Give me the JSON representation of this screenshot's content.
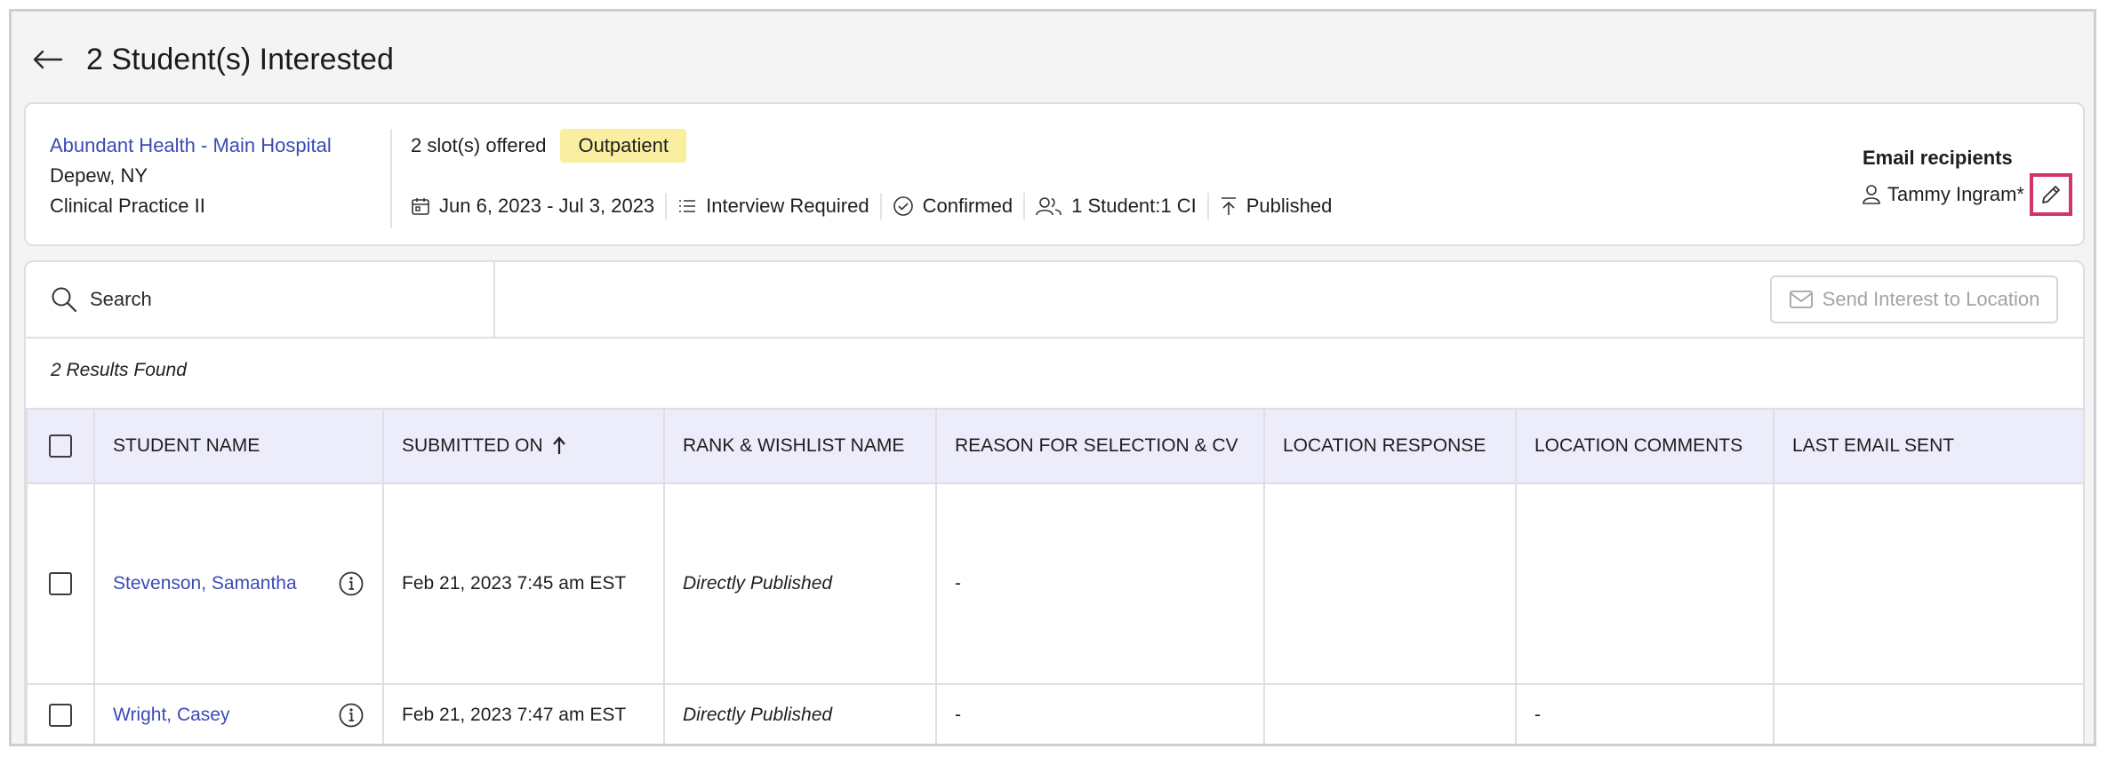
{
  "header": {
    "title": "2 Student(s) Interested"
  },
  "location": {
    "name": "Abundant Health - Main Hospital",
    "city": "Depew, NY",
    "program": "Clinical Practice II"
  },
  "slots": {
    "offered": "2 slot(s) offered",
    "badge": "Outpatient"
  },
  "meta": {
    "dates": "Jun 6, 2023 - Jul 3, 2023",
    "interview": "Interview Required",
    "status": "Confirmed",
    "ratio": "1 Student:1 CI",
    "published": "Published"
  },
  "recipients": {
    "title": "Email recipients",
    "name": "Tammy Ingram*"
  },
  "toolbar": {
    "search_label": "Search",
    "send_label": "Send Interest to Location"
  },
  "results_text": "2 Results Found",
  "table": {
    "headers": [
      "STUDENT NAME",
      "SUBMITTED ON",
      "RANK & WISHLIST NAME",
      "REASON FOR SELECTION & CV",
      "LOCATION RESPONSE",
      "LOCATION COMMENTS",
      "LAST EMAIL SENT"
    ],
    "rows": [
      {
        "name": "Stevenson, Samantha",
        "submitted": "Feb 21, 2023 7:45 am EST",
        "rank": "Directly Published",
        "reason": "-",
        "response": "",
        "comments": "",
        "last_email": ""
      },
      {
        "name": "Wright, Casey",
        "submitted": "Feb 21, 2023 7:47 am EST",
        "rank": "Directly Published",
        "reason": "-",
        "response": "",
        "comments": "-",
        "last_email": ""
      }
    ]
  },
  "colors": {
    "link": "#3b4bb4",
    "badge_bg": "#faeea0",
    "header_bg": "#ececfb",
    "highlight": "#d2336e"
  }
}
